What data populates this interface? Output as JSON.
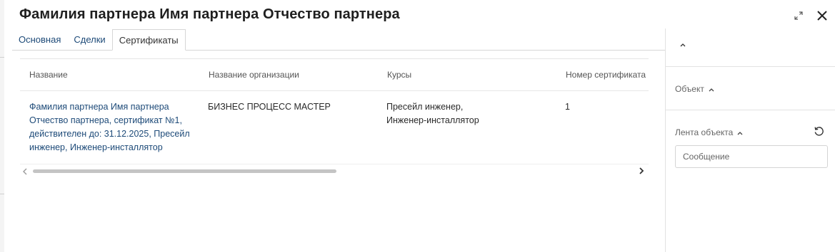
{
  "header": {
    "title": "Фамилия партнера Имя  партнера Отчество  партнера",
    "expand_icon": "expand-icon",
    "close_icon": "close-icon"
  },
  "tabs": [
    {
      "label": "Основная",
      "active": false
    },
    {
      "label": "Сделки",
      "active": false
    },
    {
      "label": "Сертификаты",
      "active": true
    }
  ],
  "table": {
    "columns": [
      "Название",
      "Название организации",
      "Курсы",
      "Номер сертификата"
    ],
    "rows": [
      {
        "name": "Фамилия партнера Имя  партнера Отчество  партнера, сертификат №1, действителен до: 31.12.2025, Пресейл инженер, Инженер-инсталлятор",
        "organization": "БИЗНЕС ПРОЦЕСС МАСТЕР",
        "courses": "Пресейл инженер, Инженер-инсталлятор",
        "number": "1"
      }
    ]
  },
  "sidebar": {
    "object_label": "Объект",
    "feed_label": "Лента объекта",
    "message_placeholder": "Сообщение"
  },
  "colors": {
    "link": "#1d4a78",
    "border": "#d6d6d6",
    "scroll_thumb": "#c4c4c4"
  }
}
